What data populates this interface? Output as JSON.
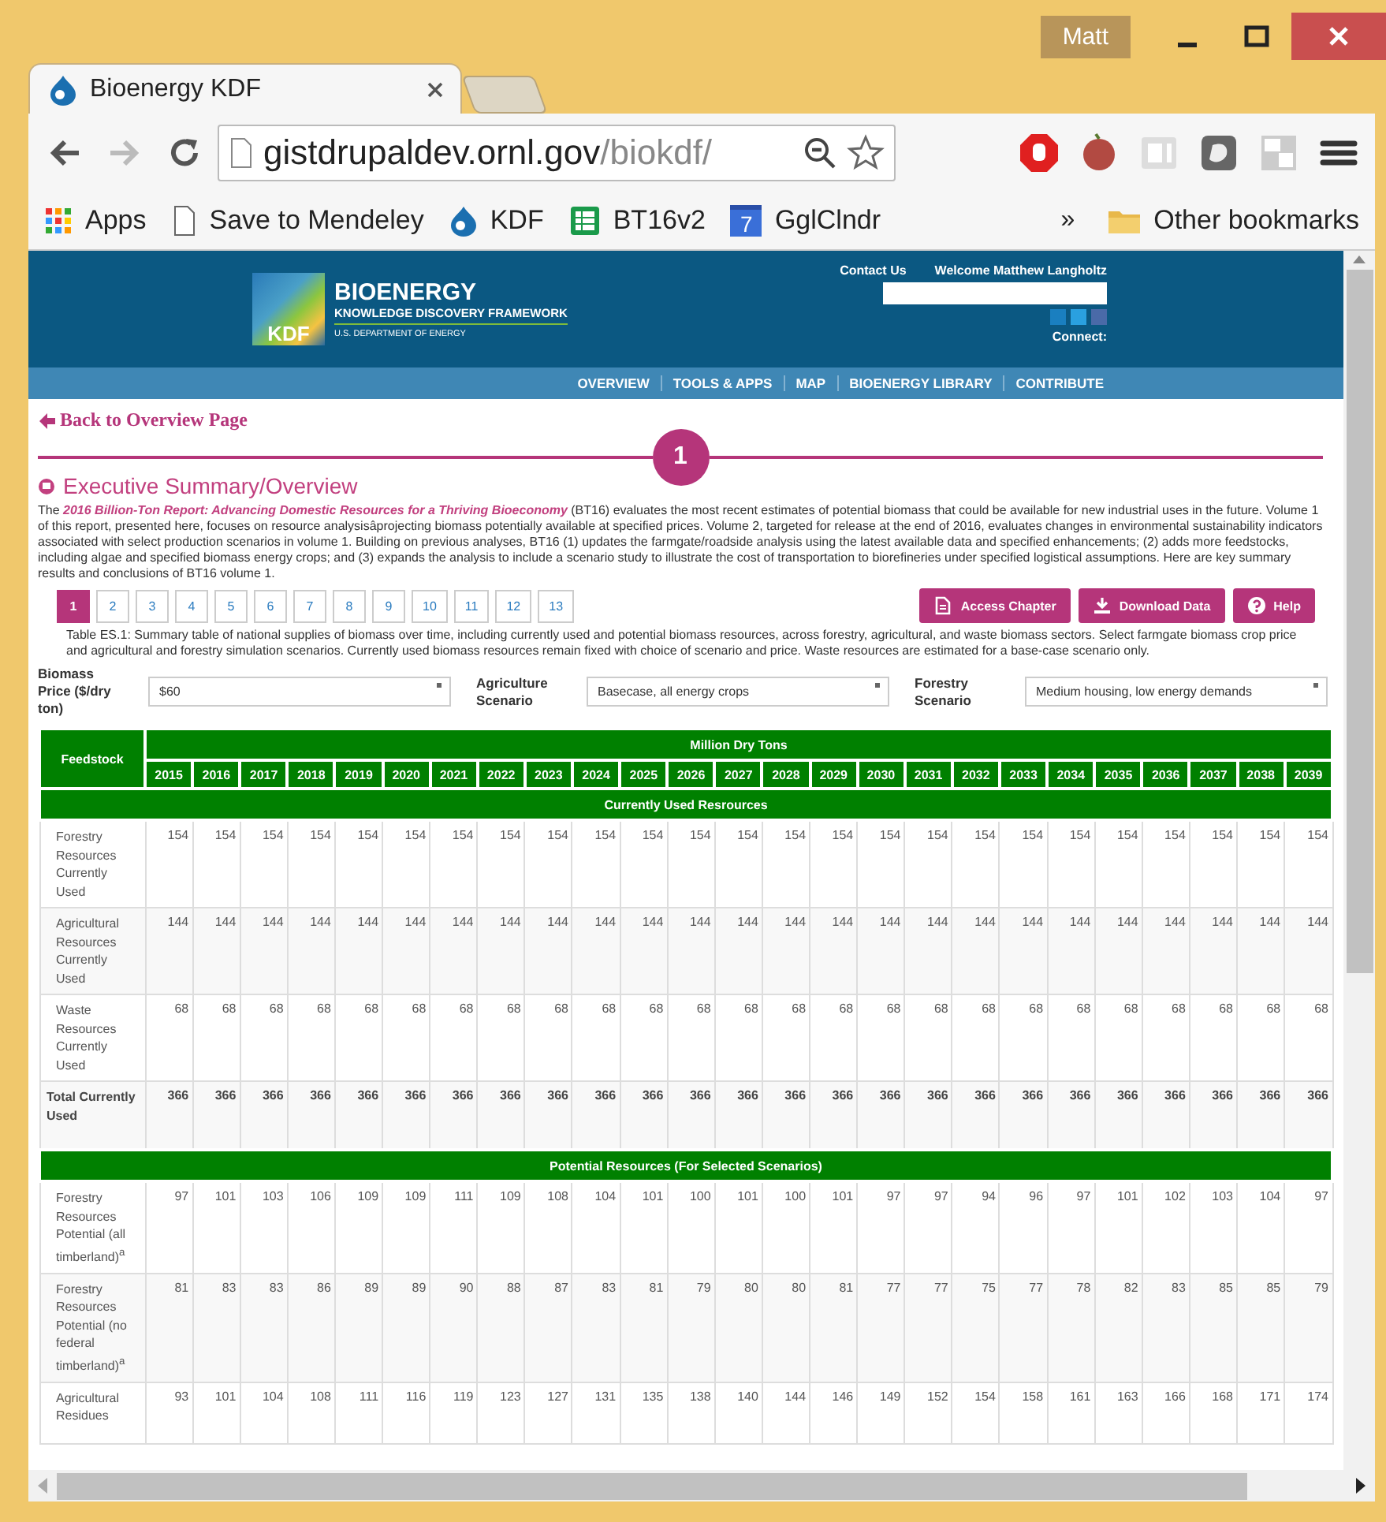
{
  "browser": {
    "profile": "Matt",
    "tabs": [
      {
        "title": "Bioenergy KDF",
        "selected": true
      }
    ],
    "address": {
      "host": "gistdrupaldev.ornl.gov",
      "path": "/biokdf/"
    },
    "bookmarks": [
      {
        "kind": "apps",
        "label": "Apps"
      },
      {
        "kind": "page",
        "label": "Save to Mendeley"
      },
      {
        "kind": "drop",
        "label": "KDF"
      },
      {
        "kind": "sheet",
        "label": "BT16v2"
      },
      {
        "kind": "calendar",
        "label": "GglClndr",
        "badge": "7"
      }
    ],
    "overflow": "»",
    "other": {
      "kind": "folder",
      "label": "Other bookmarks"
    }
  },
  "page": {
    "header": {
      "logo_mark": "KDF",
      "title": "BIOENERGY",
      "subtitle": "KNOWLEDGE DISCOVERY FRAMEWORK",
      "agency": "U.S. DEPARTMENT OF ENERGY",
      "contact": "Contact Us",
      "welcome": "Welcome Matthew Langholtz",
      "connect": "Connect:",
      "social": [
        {
          "kind": "linkedin"
        },
        {
          "kind": "twitter"
        },
        {
          "kind": "facebook"
        }
      ]
    },
    "nav": [
      "OVERVIEW",
      "TOOLS & APPS",
      "MAP",
      "BIOENERGY LIBRARY",
      "CONTRIBUTE"
    ],
    "back_link": "Back to Overview Page",
    "step": "1",
    "section_title": "Executive Summary/Overview",
    "intro": "The **2016 Billion-Ton Report: Advancing Domestic Resources for a Thriving Bioeconomy** (BT16) evaluates the most recent estimates of potential biomass that could be available for new industrial uses in the future. Volume 1 of this report, presented here, focuses on resource analysisâprojecting biomass potentially available at specified prices. Volume 2, targeted for release at the end of 2016, evaluates changes in environmental sustainability indicators associated with select production scenarios in volume 1. Building on previous analyses, BT16 (1) updates the farmgate/roadside analysis using the latest available data and specified enhancements; (2) adds more feedstocks, including algae and specified biomass energy crops; and (3) expands the analysis to include a scenario study to illustrate the cost of transportation to biorefineries under specified logistical assumptions. Here are key summary results and conclusions of BT16 volume 1.",
    "pages": [
      {
        "label": "1",
        "selected": true
      },
      {
        "label": "2",
        "selected": false
      },
      {
        "label": "3",
        "selected": false
      },
      {
        "label": "4",
        "selected": false
      },
      {
        "label": "5",
        "selected": false
      },
      {
        "label": "6",
        "selected": false
      },
      {
        "label": "7",
        "selected": false
      },
      {
        "label": "8",
        "selected": false
      },
      {
        "label": "9",
        "selected": false
      },
      {
        "label": "10",
        "selected": false
      },
      {
        "label": "11",
        "selected": false
      },
      {
        "label": "12",
        "selected": false
      },
      {
        "label": "13",
        "selected": false
      }
    ],
    "buttons": [
      {
        "kind": "document",
        "label": "Access Chapter"
      },
      {
        "kind": "download",
        "label": "Download Data"
      },
      {
        "kind": "help",
        "label": "Help"
      }
    ],
    "caption": "Table ES.1: Summary table of national supplies of biomass over time, including currently used and potential biomass resources, across forestry, agricultural, and waste biomass sectors. Select farmgate biomass crop price and agricultural and forestry simulation scenarios. Currently used biomass resources remain fixed with choice of scenario and price. Waste resources are estimated for a base-case scenario only.",
    "filters": [
      {
        "label": "Biomass Price ($/dry ton)",
        "value": "$60"
      },
      {
        "label": "Agriculture Scenario",
        "value": "Basecase, all energy crops"
      },
      {
        "label": "Forestry Scenario",
        "value": "Medium housing, low energy demands"
      }
    ],
    "table": {
      "row_header": "Feedstock",
      "group_header": "Million Dry Tons",
      "years": [
        "2015",
        "2016",
        "2017",
        "2018",
        "2019",
        "2020",
        "2021",
        "2022",
        "2023",
        "2024",
        "2025",
        "2026",
        "2027",
        "2028",
        "2029",
        "2030",
        "2031",
        "2032",
        "2033",
        "2034",
        "2035",
        "2036",
        "2037",
        "2038",
        "2039"
      ],
      "sections": [
        {
          "title": "Currently Used Resrources",
          "rows": [
            {
              "kind": "item",
              "label": "Forestry Resources Currently Used",
              "values": [
                "154",
                "154",
                "154",
                "154",
                "154",
                "154",
                "154",
                "154",
                "154",
                "154",
                "154",
                "154",
                "154",
                "154",
                "154",
                "154",
                "154",
                "154",
                "154",
                "154",
                "154",
                "154",
                "154",
                "154",
                "154"
              ]
            },
            {
              "kind": "item",
              "label": "Agricultural Resources Currently Used",
              "values": [
                "144",
                "144",
                "144",
                "144",
                "144",
                "144",
                "144",
                "144",
                "144",
                "144",
                "144",
                "144",
                "144",
                "144",
                "144",
                "144",
                "144",
                "144",
                "144",
                "144",
                "144",
                "144",
                "144",
                "144",
                "144"
              ]
            },
            {
              "kind": "item",
              "label": "Waste Resources Currently Used",
              "values": [
                "68",
                "68",
                "68",
                "68",
                "68",
                "68",
                "68",
                "68",
                "68",
                "68",
                "68",
                "68",
                "68",
                "68",
                "68",
                "68",
                "68",
                "68",
                "68",
                "68",
                "68",
                "68",
                "68",
                "68",
                "68"
              ]
            },
            {
              "kind": "total",
              "label": "Total Currently Used",
              "values": [
                "366",
                "366",
                "366",
                "366",
                "366",
                "366",
                "366",
                "366",
                "366",
                "366",
                "366",
                "366",
                "366",
                "366",
                "366",
                "366",
                "366",
                "366",
                "366",
                "366",
                "366",
                "366",
                "366",
                "366",
                "366"
              ]
            }
          ]
        },
        {
          "title": "Potential Resources (For Selected Scenarios)",
          "rows": [
            {
              "kind": "item",
              "label": "Forestry Resources Potential (all timberland)$^{a}$",
              "values": [
                "97",
                "101",
                "103",
                "106",
                "109",
                "109",
                "111",
                "109",
                "108",
                "104",
                "101",
                "100",
                "101",
                "100",
                "101",
                "97",
                "97",
                "94",
                "96",
                "97",
                "101",
                "102",
                "103",
                "104",
                "97"
              ]
            },
            {
              "kind": "item",
              "label": "Forestry Resources Potential (no federal timberland)$^{a}$",
              "values": [
                "81",
                "83",
                "83",
                "86",
                "89",
                "89",
                "90",
                "88",
                "87",
                "83",
                "81",
                "79",
                "80",
                "80",
                "81",
                "77",
                "77",
                "75",
                "77",
                "78",
                "82",
                "83",
                "85",
                "85",
                "79"
              ]
            },
            {
              "kind": "item",
              "label": "Agricultural Residues",
              "values": [
                "93",
                "101",
                "104",
                "108",
                "111",
                "116",
                "119",
                "123",
                "127",
                "131",
                "135",
                "138",
                "140",
                "144",
                "146",
                "149",
                "152",
                "154",
                "158",
                "161",
                "163",
                "166",
                "168",
                "171",
                "174"
              ]
            }
          ]
        }
      ]
    }
  }
}
